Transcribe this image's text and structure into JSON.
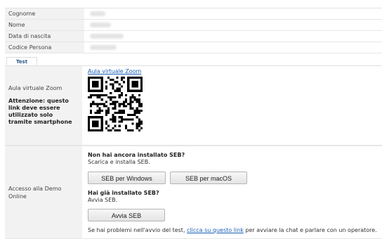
{
  "profile": {
    "rows": [
      {
        "label": "Cognome",
        "value": ""
      },
      {
        "label": "Nome",
        "value": ""
      },
      {
        "label": "Data di nascita",
        "value": ""
      },
      {
        "label": "Codice Persona",
        "value": ""
      }
    ]
  },
  "tabs": [
    {
      "label": "Test",
      "active": true
    }
  ],
  "zoom": {
    "label": "Aula virtuale Zoom",
    "warning": "Attenzione: questo link deve essere utilizzato solo tramite smartphone",
    "link": "Aula virtuale Zoom",
    "qr_icon": "qr-code-icon"
  },
  "demo": {
    "label": "Accesso alla Demo Online",
    "no_seb_title": "Non hai ancora installato SEB?",
    "no_seb_text": "Scarica e installa SEB.",
    "btn_windows": "SEB per Windows",
    "btn_macos": "SEB per macOS",
    "has_seb_title": "Hai già installato SEB?",
    "has_seb_text": "Avvia SEB.",
    "btn_avvia": "Avvia SEB",
    "help_pre": "Se hai problemi nell'avvio del test, ",
    "help_link": "clicca su questo link",
    "help_post": " per avviare la chat e parlare con un operatore."
  },
  "colors": {
    "accent": "#1a5fb4",
    "label_bg": "#f2f2f2",
    "tab_text": "#2a5a8a"
  }
}
